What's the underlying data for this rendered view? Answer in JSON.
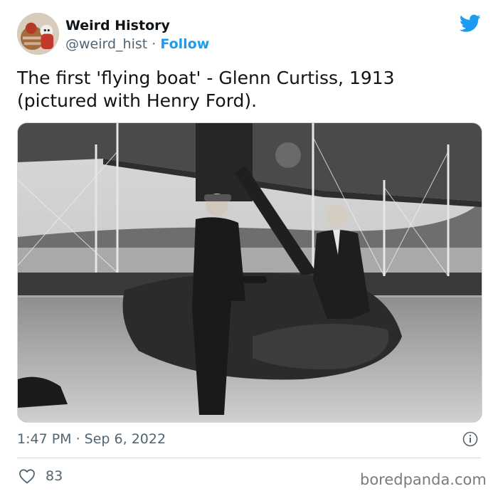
{
  "author": {
    "name": "Weird History",
    "handle": "@weird_hist",
    "separator": "·",
    "follow_label": "Follow"
  },
  "tweet": {
    "text_line1": "The first 'flying boat' - Glenn Curtiss, 1913",
    "text_line2": "(pictured with Henry Ford).",
    "timestamp": "1:47 PM · Sep 6, 2022",
    "likes": "83"
  },
  "icons": {
    "platform": "twitter-bird-icon",
    "info": "info-icon",
    "like": "heart-icon"
  },
  "watermark": "boredpanda.com",
  "colors": {
    "accent": "#1d9bf0",
    "secondary_text": "#536471",
    "primary_text": "#0f1419",
    "divider": "#cfd9de"
  }
}
